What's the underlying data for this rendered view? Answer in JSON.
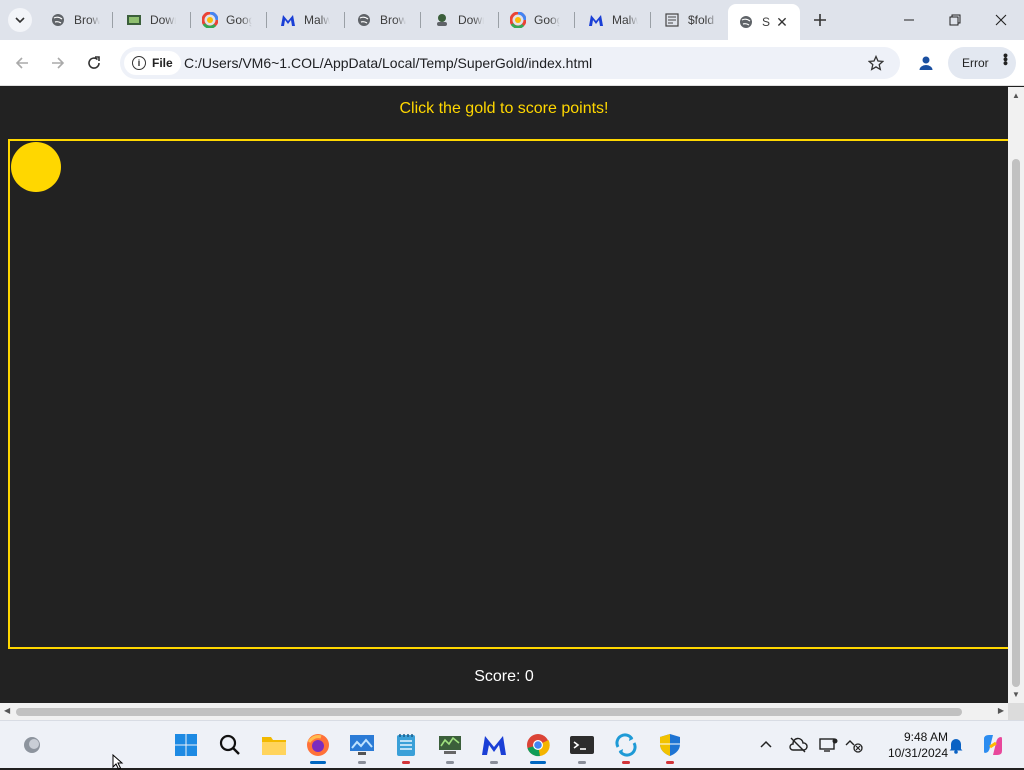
{
  "browser": {
    "tabs": [
      {
        "title": "Brows",
        "icon": "globe-icon"
      },
      {
        "title": "Down",
        "icon": "download-icon"
      },
      {
        "title": "Goog",
        "icon": "google-icon"
      },
      {
        "title": "Malw",
        "icon": "malwarebytes-icon"
      },
      {
        "title": "Brows",
        "icon": "globe-icon"
      },
      {
        "title": "Down",
        "icon": "download-icon"
      },
      {
        "title": "Goog",
        "icon": "google-icon"
      },
      {
        "title": "Malw",
        "icon": "malwarebytes-icon"
      },
      {
        "title": "$fold",
        "icon": "document-icon"
      },
      {
        "title": "S",
        "icon": "globe-icon",
        "active": true
      }
    ],
    "address": {
      "site_info_label": "File",
      "url": "C:/Users/VM6~1.COL/AppData/Local/Temp/SuperGold/index.html"
    },
    "error_label": "Error"
  },
  "page": {
    "instructions": "Click the gold to score points!",
    "score_text": "Score: 0",
    "colors": {
      "gold": "#ffd700",
      "background": "#222222",
      "text": "#ffffff"
    }
  },
  "taskbar": {
    "apps": [
      "start",
      "search",
      "file-explorer",
      "firefox",
      "remote-desktop",
      "notepad",
      "network-monitor",
      "malwarebytes",
      "chrome",
      "terminal",
      "sync-tool",
      "windows-security"
    ],
    "clock_time": "9:48 AM",
    "clock_date": "10/31/2024"
  }
}
